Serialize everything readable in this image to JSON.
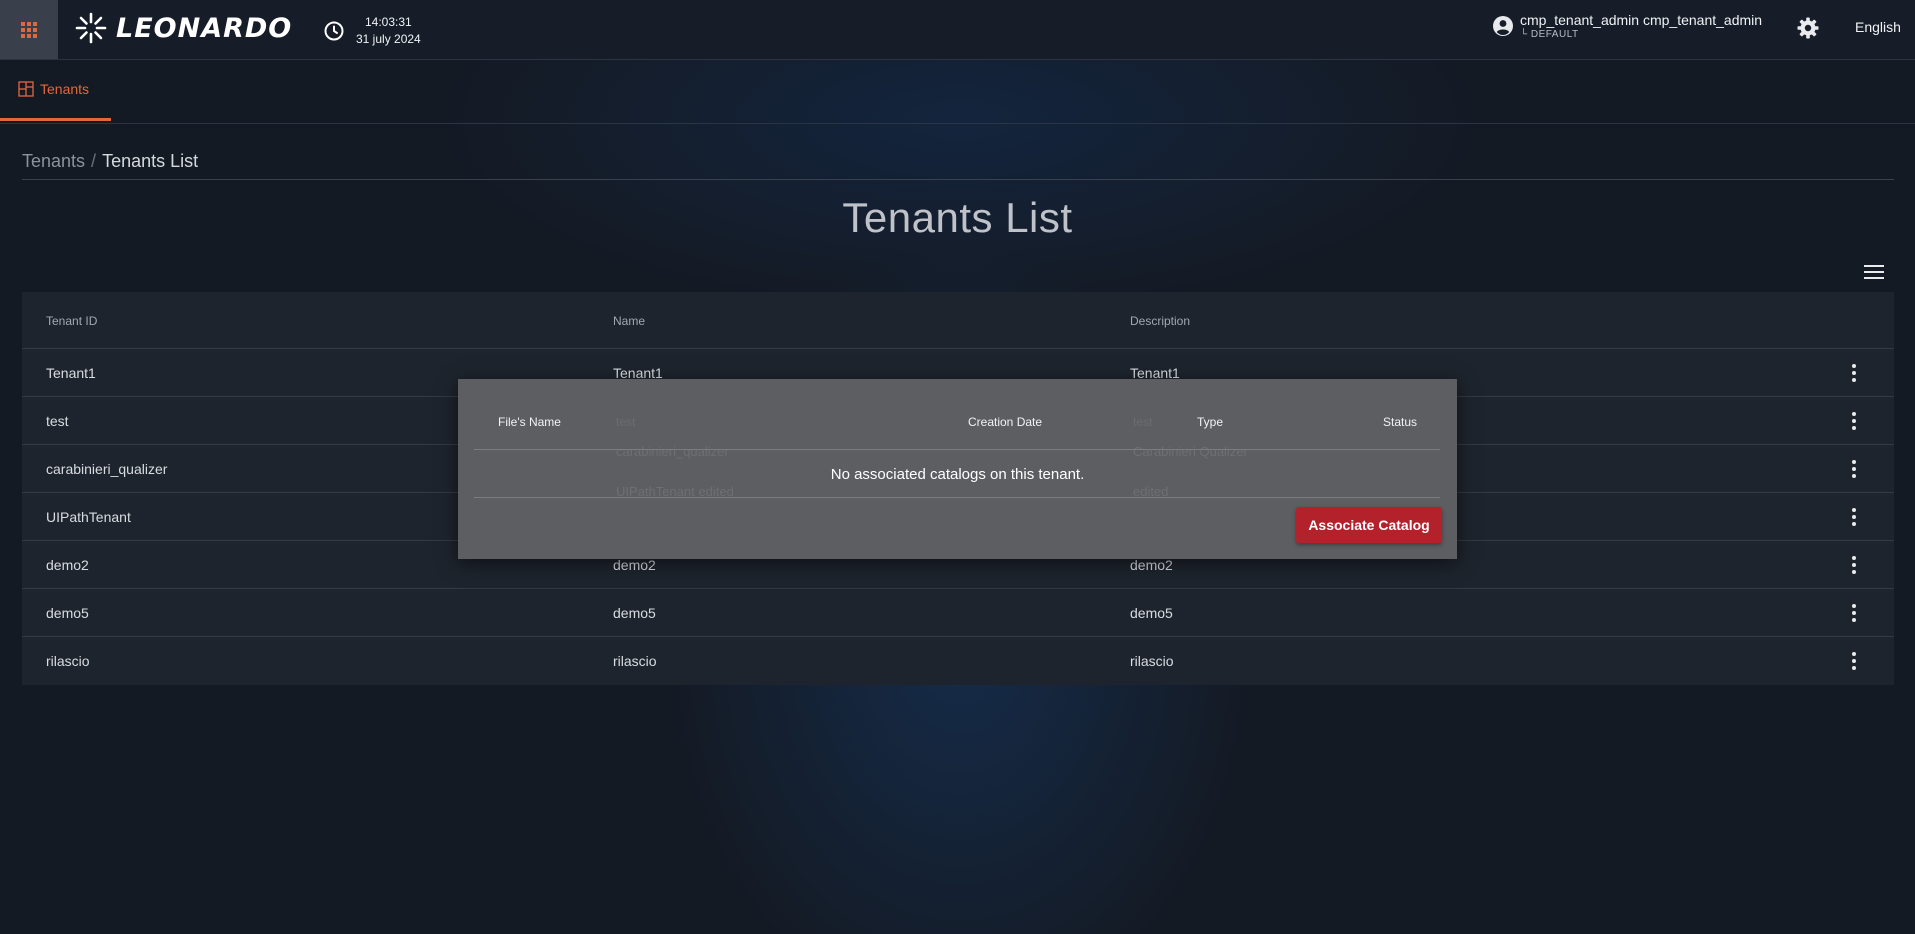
{
  "header": {
    "brand": "LEONARDO",
    "time": "14:03:31",
    "date": "31 july 2024",
    "user_name": "cmp_tenant_admin cmp_tenant_admin",
    "user_domain": "└ DEFAULT",
    "language": "English",
    "icons": [
      "apps-grid-icon",
      "leonardo-logo-icon",
      "clock-icon",
      "user-circle-icon",
      "gear-icon"
    ]
  },
  "module_tab": {
    "label": "Tenants",
    "icon": "grid-layout-icon"
  },
  "breadcrumb": {
    "parent": "Tenants",
    "separator": "/",
    "current": "Tenants List"
  },
  "page_title": "Tenants List",
  "table": {
    "columns": [
      "Tenant ID",
      "Name",
      "Description"
    ],
    "rows": [
      {
        "id": "Tenant1",
        "name": "Tenant1",
        "description": "Tenant1"
      },
      {
        "id": "test",
        "name": "test",
        "description": "test"
      },
      {
        "id": "carabinieri_qualizer",
        "name": "carabinieri_qualizer",
        "description": "Carabinieri Qualizer"
      },
      {
        "id": "UIPathTenant",
        "name": "UIPathTenant edited",
        "description": "edited"
      },
      {
        "id": "demo2",
        "name": "demo2",
        "description": "demo2"
      },
      {
        "id": "demo5",
        "name": "demo5",
        "description": "demo5"
      },
      {
        "id": "rilascio",
        "name": "rilascio",
        "description": "rilascio"
      }
    ]
  },
  "modal": {
    "columns": [
      "File's Name",
      "Creation Date",
      "Type",
      "Status"
    ],
    "empty_message": "No associated catalogs on this tenant.",
    "associate_button": "Associate Catalog"
  },
  "colors": {
    "accent": "#e0683d",
    "button_red": "#b3222a",
    "background": "#141a24",
    "table_bg": "#1e242d",
    "modal_bg": "#5c5e61"
  }
}
